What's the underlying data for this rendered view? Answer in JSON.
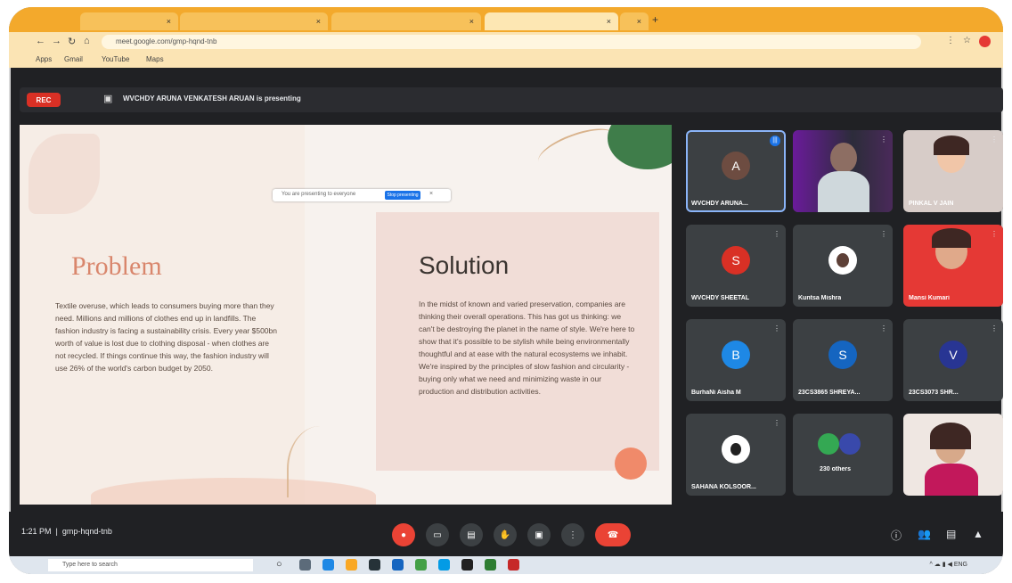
{
  "browser": {
    "tabs": [
      "",
      "",
      "",
      "",
      ""
    ],
    "url": "meet.google.com/gmp-hqnd-tnb",
    "bookmarks": [
      "Apps",
      "Gmail",
      "YouTube",
      "Maps"
    ]
  },
  "meet": {
    "rec_label": "REC",
    "presenting_text": "WVCHDY ARUNA VENKATESH ARUAN is presenting",
    "meeting_code": "gmp-hqnd-tnb",
    "time": "1:21 PM"
  },
  "slide": {
    "control_label": "You are presenting to everyone",
    "control_button": "Stop presenting",
    "problem": {
      "title": "Problem",
      "body": "Textile overuse, which leads to consumers buying more than they need. Millions and millions of clothes end up in landfills. The fashion industry is facing a sustainability crisis. Every year $500bn worth of value is lost due to clothing disposal - when clothes are not recycled. If things continue this way, the fashion industry will use 26% of the world's carbon budget by 2050."
    },
    "solution": {
      "title": "Solution",
      "body": "In the midst of known and varied preservation, companies are thinking their overall operations. This has got us thinking: we can't be destroying the planet in the name of style. We're here to show that it's possible to be stylish while being environmentally thoughtful and at ease with the natural ecosystems we inhabit. We're inspired by the principles of slow fashion and circularity - buying only what we need and minimizing waste in our production and distribution activities."
    }
  },
  "participants": [
    {
      "name": "WVCHDY ARUNA...",
      "initial": "A",
      "color": "#6d4c41",
      "speaking": true
    },
    {
      "name": "",
      "initial": "",
      "color": "",
      "photo": true
    },
    {
      "name": "PINKAL V JAIN",
      "initial": "",
      "color": "",
      "photo": true
    },
    {
      "name": "WVCHDY SHEETAL",
      "initial": "S",
      "color": "#d93025"
    },
    {
      "name": "Kuntsa Mishra",
      "initial": "",
      "color": "#ffffff",
      "photo_avatar": true
    },
    {
      "name": "Mansi Kumari",
      "initial": "",
      "color": "",
      "photo": true
    },
    {
      "name": "BurhaNi Aisha M",
      "initial": "B",
      "color": "#1e88e5"
    },
    {
      "name": "23CS3865 SHREYA...",
      "initial": "S",
      "color": "#1565c0"
    },
    {
      "name": "23CS3073 SHR...",
      "initial": "V",
      "color": "#283593"
    },
    {
      "name": "SAHANA KOLSOOR...",
      "initial": "",
      "color": "#ffffff",
      "photo_avatar": true
    },
    {
      "name": "230 others",
      "initial": "",
      "color": "#34a853",
      "others": true
    },
    {
      "name": "",
      "initial": "",
      "color": "",
      "photo": true
    }
  ],
  "taskbar": {
    "search_placeholder": "Type here to search"
  }
}
